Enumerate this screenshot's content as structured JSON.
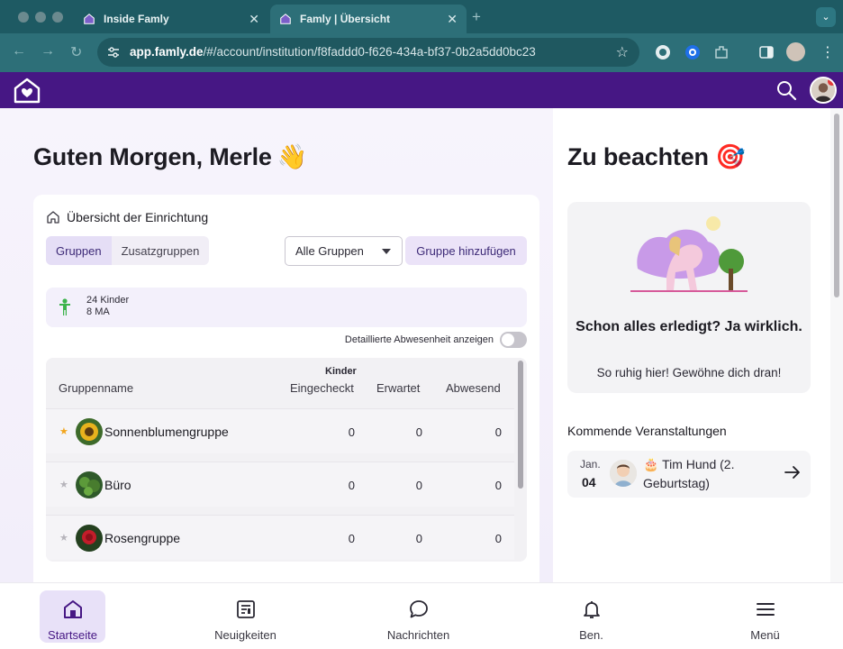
{
  "browser": {
    "tabs": [
      {
        "title": "Inside Famly",
        "active": false
      },
      {
        "title": "Famly | Übersicht",
        "active": true
      }
    ],
    "url_host": "app.famly.de",
    "url_path": "/#/account/institution/f8faddd0-f626-434a-bf37-0b2a5dd0bc23"
  },
  "app": {
    "brand_color": "#461784",
    "greeting": "Guten Morgen, Merle",
    "greeting_emoji": "👋",
    "overview": {
      "title": "Übersicht der Einrichtung",
      "segments": [
        "Gruppen",
        "Zusatzgruppen"
      ],
      "active_segment": "Gruppen",
      "group_select": "Alle Gruppen",
      "add_group": "Gruppe hinzufügen",
      "summary": {
        "children_count": "24",
        "children_label": "Kinder",
        "staff_count": "8",
        "staff_label": "MA"
      },
      "absence_toggle": {
        "label": "Detaillierte Abwesenheit anzeigen",
        "on": false
      },
      "table": {
        "col_name": "Gruppenname",
        "col_super": "Kinder",
        "col_checked_in": "Eingecheckt",
        "col_expected": "Erwartet",
        "col_absent": "Abwesend",
        "rows": [
          {
            "name": "Sonnenblumengruppe",
            "starred": true,
            "checked_in": "0",
            "expected": "0",
            "absent": "0"
          },
          {
            "name": "Büro",
            "starred": false,
            "checked_in": "0",
            "expected": "0",
            "absent": "0"
          },
          {
            "name": "Rosengruppe",
            "starred": false,
            "checked_in": "0",
            "expected": "0",
            "absent": "0"
          }
        ]
      }
    },
    "notes": {
      "title": "Zu beachten",
      "title_emoji": "🎯",
      "empty_heading": "Schon alles erledigt? Ja wirklich.",
      "empty_sub": "So ruhig hier! Gewöhne dich dran!"
    },
    "events": {
      "title": "Kommende Veranstaltungen",
      "items": [
        {
          "month": "Jan.",
          "day": "04",
          "text": "🎂 Tim Hund (2. Geburtstag)"
        }
      ]
    },
    "bottom_nav": [
      {
        "label": "Startseite",
        "icon": "home-icon",
        "active": true
      },
      {
        "label": "Neuigkeiten",
        "icon": "newspaper-icon",
        "active": false
      },
      {
        "label": "Nachrichten",
        "icon": "chat-bubble-icon",
        "active": false
      },
      {
        "label": "Ben.",
        "icon": "bell-icon",
        "active": false
      },
      {
        "label": "Menü",
        "icon": "hamburger-menu-icon",
        "active": false
      }
    ]
  }
}
